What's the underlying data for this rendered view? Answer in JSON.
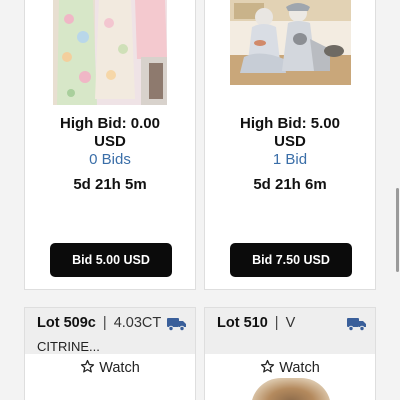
{
  "lots": [
    {
      "image_icon": "clothing-photo",
      "high_bid_label": "High Bid: 0.00",
      "currency": "USD",
      "bids_label": "0 Bids",
      "time_left": "5d 21h 5m",
      "bid_button_label": "Bid 5.00 USD"
    },
    {
      "image_icon": "figurines-photo",
      "high_bid_label": "High Bid: 5.00",
      "currency": "USD",
      "bids_label": "1 Bid",
      "time_left": "5d 21h 6m",
      "bid_button_label": "Bid 7.50 USD"
    },
    {
      "lot_number": "Lot 509c",
      "separator": "|",
      "description": "4.03CT",
      "description_line2": "CITRINE...",
      "shipping_icon": "truck-icon",
      "watch_label": "Watch"
    },
    {
      "lot_number": "Lot 510",
      "separator": "|",
      "description": "V",
      "shipping_icon": "truck-icon",
      "watch_label": "Watch",
      "image_icon": "item-photo"
    }
  ],
  "colors": {
    "accent_link": "#3a6ea8",
    "button_bg": "#0b0b0b",
    "truck_icon": "#3a5f9a"
  }
}
